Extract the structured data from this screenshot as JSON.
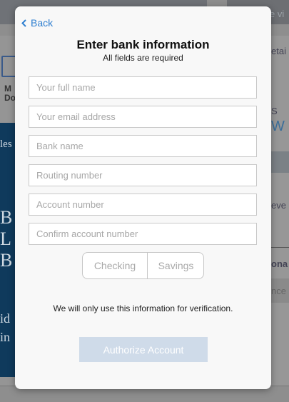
{
  "background": {
    "topbar_right_fragment": "e vi",
    "left_doc_label_line1": "M",
    "left_doc_label_line2": "Do",
    "left_hero_fragments": [
      "les",
      "B",
      "L",
      "B",
      "id",
      "in"
    ],
    "right_fragments": [
      "etai",
      "S",
      "W",
      "eve",
      "ona",
      "nce"
    ]
  },
  "modal": {
    "back_label": "Back",
    "title": "Enter bank information",
    "subtitle": "All fields are required",
    "fields": {
      "full_name": {
        "placeholder": "Your full name",
        "value": ""
      },
      "email": {
        "placeholder": "Your email address",
        "value": ""
      },
      "bank_name": {
        "placeholder": "Bank name",
        "value": ""
      },
      "routing_number": {
        "placeholder": "Routing number",
        "value": ""
      },
      "account_number": {
        "placeholder": "Account number",
        "value": ""
      },
      "confirm_account_number": {
        "placeholder": "Confirm account number",
        "value": ""
      }
    },
    "account_type": {
      "checking_label": "Checking",
      "savings_label": "Savings"
    },
    "note": "We will only use this information for verification.",
    "authorize_label": "Authorize Account"
  },
  "colors": {
    "accent_link": "#2f7fd0",
    "authorize_disabled": "#cfdbe9",
    "overlay": "#8e8e8e"
  }
}
